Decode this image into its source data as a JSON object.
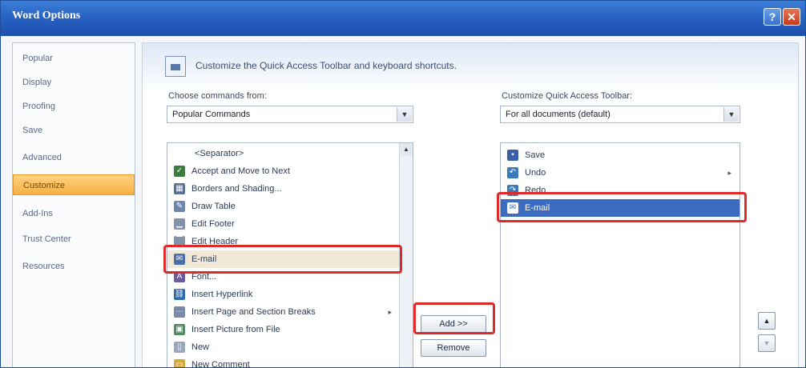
{
  "window": {
    "title": "Word Options",
    "help_glyph": "?",
    "close_glyph": "✕"
  },
  "nav": {
    "items": [
      {
        "label": "Popular"
      },
      {
        "label": "Display"
      },
      {
        "label": "Proofing"
      },
      {
        "label": "Save"
      },
      {
        "label": "Advanced"
      },
      {
        "label": "Customize"
      },
      {
        "label": "Add-Ins"
      },
      {
        "label": "Trust Center"
      },
      {
        "label": "Resources"
      }
    ],
    "active": "Customize"
  },
  "header": {
    "text": "Customize the Quick Access Toolbar and keyboard shortcuts."
  },
  "left_panel": {
    "label": "Choose commands from:",
    "combo_value": "Popular Commands",
    "items": [
      {
        "label": "<Separator>",
        "icon": "none"
      },
      {
        "label": "Accept and Move to Next",
        "icon": "accept-icon"
      },
      {
        "label": "Borders and Shading...",
        "icon": "borders-icon"
      },
      {
        "label": "Draw Table",
        "icon": "draw-table-icon"
      },
      {
        "label": "Edit Footer",
        "icon": "footer-icon"
      },
      {
        "label": "Edit Header",
        "icon": "header-icon"
      },
      {
        "label": "E-mail",
        "icon": "email-icon"
      },
      {
        "label": "Font...",
        "icon": "font-icon"
      },
      {
        "label": "Insert Hyperlink",
        "icon": "hyperlink-icon"
      },
      {
        "label": "Insert Page and Section Breaks",
        "icon": "breaks-icon",
        "has_submenu": true
      },
      {
        "label": "Insert Picture from File",
        "icon": "picture-icon"
      },
      {
        "label": "New",
        "icon": "new-doc-icon"
      },
      {
        "label": "New Comment",
        "icon": "comment-icon"
      }
    ],
    "selected": "E-mail"
  },
  "buttons": {
    "add": "Add >>",
    "remove": "Remove"
  },
  "right_panel": {
    "label": "Customize Quick Access Toolbar:",
    "combo_value": "For all documents (default)",
    "items": [
      {
        "label": "Save",
        "icon": "save-icon"
      },
      {
        "label": "Undo",
        "icon": "undo-icon"
      },
      {
        "label": "Redo",
        "icon": "redo-icon"
      },
      {
        "label": "E-mail",
        "icon": "email-icon"
      }
    ],
    "selected": "E-mail"
  },
  "glyphs": {
    "dropdown": "▼",
    "scroll_up": "▲",
    "submenu": "▸",
    "move_up": "▲",
    "move_down": "▼"
  },
  "colors": {
    "title_bar": "#2a63c2",
    "highlight_box": "#e02a2a",
    "selection": "#3b6cbf",
    "active_nav": "#f7b043"
  }
}
